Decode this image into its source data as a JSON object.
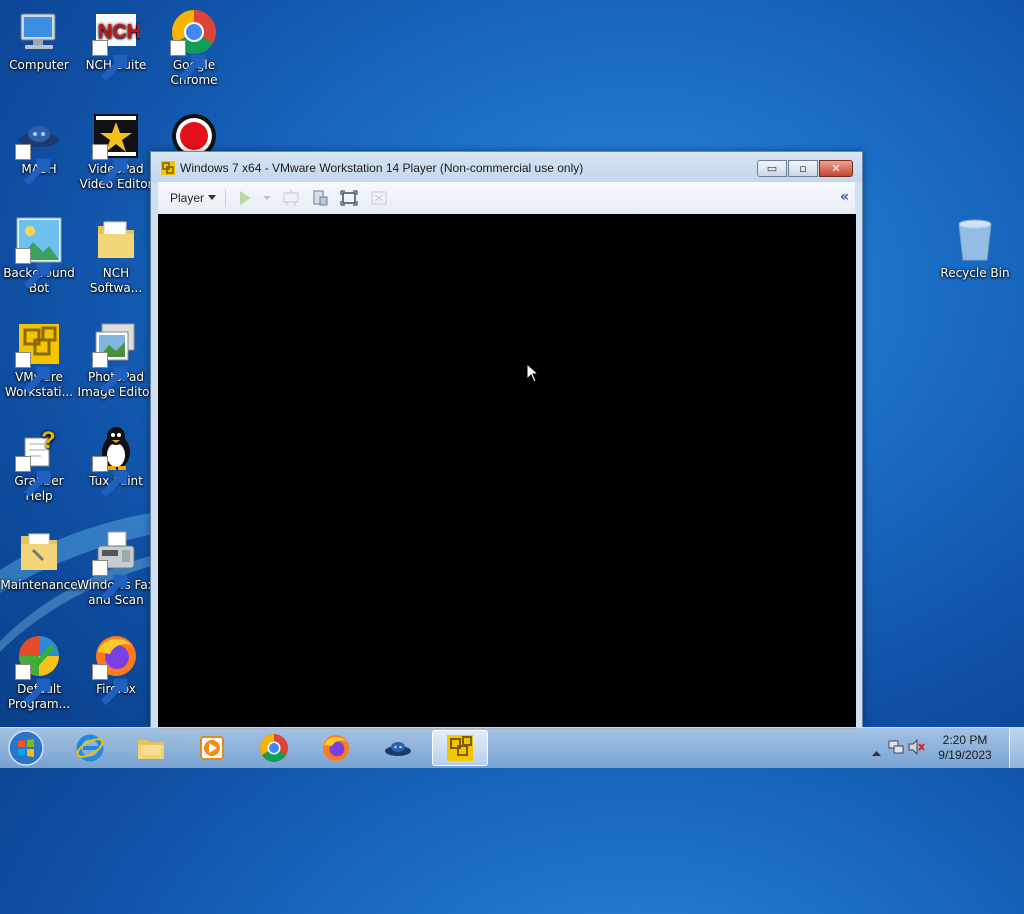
{
  "desktop": {
    "icons": [
      {
        "label": "Computer",
        "icon": "computer-icon"
      },
      {
        "label": "NCH Suite",
        "icon": "nch-suite-icon"
      },
      {
        "label": "Google Chrome",
        "icon": "chrome-icon"
      },
      {
        "label": "MASH",
        "icon": "mash-icon"
      },
      {
        "label": "VideoPad Video Editor",
        "icon": "videopad-icon"
      },
      {
        "label": "Background Bot",
        "icon": "background-bot-icon"
      },
      {
        "label": "NCH Softwa...",
        "icon": "folder-icon"
      },
      {
        "label": "VMware Workstati...",
        "icon": "vmware-icon"
      },
      {
        "label": "PhotoPad Image Editor",
        "icon": "photopad-icon"
      },
      {
        "label": "Grabber Help",
        "icon": "help-icon"
      },
      {
        "label": "Tux Paint",
        "icon": "tux-paint-icon"
      },
      {
        "label": "Maintenance",
        "icon": "folder-icon"
      },
      {
        "label": "Windows Fax and Scan",
        "icon": "fax-scan-icon"
      },
      {
        "label": "Default Program...",
        "icon": "default-programs-icon"
      },
      {
        "label": "Firefox",
        "icon": "firefox-icon"
      },
      {
        "label": "Recycle Bin",
        "icon": "recycle-bin-icon"
      }
    ]
  },
  "vm_window": {
    "title": "Windows 7 x64 - VMware Workstation 14 Player (Non-commercial use only)",
    "player_menu": "Player",
    "buttons": {
      "minimize": "▭",
      "maximize": "▫",
      "close": "✕"
    },
    "collapse_symbol": "«"
  },
  "taskbar": {
    "pinned": [
      "internet-explorer-icon",
      "explorer-icon",
      "media-player-icon",
      "chrome-icon",
      "firefox-icon",
      "mash-icon",
      "vmware-icon"
    ],
    "active": "vmware-icon",
    "clock": {
      "time": "2:20 PM",
      "date": "9/19/2023"
    }
  },
  "colors": {
    "desktop": "#1a6cc4",
    "vm_screen": "#000000",
    "close_button": "#c9452e"
  }
}
